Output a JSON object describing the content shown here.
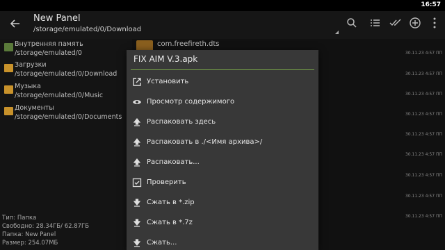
{
  "status_bar": {
    "time": "16:57"
  },
  "toolbar": {
    "title": "New Panel",
    "path": "/storage/emulated/0/Download",
    "icons": [
      "back-arrow-icon",
      "search-icon",
      "list-view-icon",
      "select-all-icon",
      "add-icon",
      "settings-icon"
    ]
  },
  "left_panel": {
    "items": [
      {
        "name": "Внутренняя память",
        "path": "/storage/emulated/0",
        "icon": "sd-card-icon"
      },
      {
        "name": "Загрузки",
        "path": "/storage/emulated/0/Download",
        "icon": "folder-icon"
      },
      {
        "name": "Музыка",
        "path": "/storage/emulated/0/Music",
        "icon": "folder-icon"
      },
      {
        "name": "Документы",
        "path": "/storage/emulated/0/Documents",
        "icon": "folder-icon"
      }
    ],
    "info": {
      "type": "Тип: Папка",
      "free": "Свободно: 28.34ГБ/ 62.87ГБ",
      "folder": "Папка: New Panel",
      "size": "Размер: 254.07МБ"
    }
  },
  "right_panel": {
    "top_item": "com.freefireth.dts",
    "dates": [
      "30.11.23 4:57 ПП",
      "30.11.23 4:57 ПП",
      "30.11.23 4:57 ПП",
      "30.11.23 4:57 ПП",
      "30.11.23 4:57 ПП",
      "30.11.23 4:57 ПП",
      "30.11.23 4:57 ПП",
      "30.11.23 4:57 ПП",
      "30.11.23 4:57 ПП"
    ]
  },
  "dialog": {
    "title": "FIX AIM V.3.apk",
    "items": [
      {
        "label": "Установить",
        "icon": "open-external-icon"
      },
      {
        "label": "Просмотр содержимого",
        "icon": "eye-icon"
      },
      {
        "label": "Распаковать здесь",
        "icon": "upload-icon"
      },
      {
        "label": "Распаковать в ./<Имя архива>/",
        "icon": "upload-icon"
      },
      {
        "label": "Распаковать...",
        "icon": "upload-icon"
      },
      {
        "label": "Проверить",
        "icon": "check-box-icon"
      },
      {
        "label": "Сжать в *.zip",
        "icon": "download-icon"
      },
      {
        "label": "Сжать в *.7z",
        "icon": "download-icon"
      },
      {
        "label": "Сжать...",
        "icon": "download-icon"
      }
    ]
  },
  "colors": {
    "accent_line": "#7aa64a",
    "folder": "#c8922b",
    "dialog_bg": "#383838"
  }
}
